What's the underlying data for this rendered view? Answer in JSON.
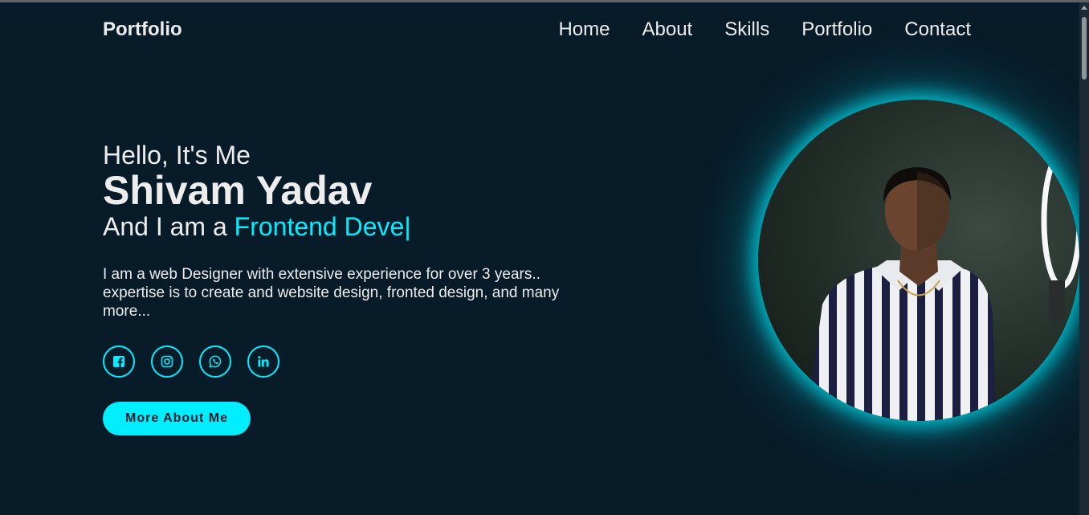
{
  "header": {
    "logo": "Portfolio",
    "nav": [
      "Home",
      "About",
      "Skills",
      "Portfolio",
      "Contact"
    ]
  },
  "hero": {
    "greeting": "Hello, It's Me",
    "name": "Shivam Yadav",
    "role_prefix": "And I am a ",
    "role_highlight": "Frontend Deve|",
    "description": "I am a web Designer with extensive experience for over 3 years.. expertise is to create and website design, fronted design, and many more...",
    "socials": [
      {
        "icon": "facebook-icon"
      },
      {
        "icon": "instagram-icon"
      },
      {
        "icon": "whatsapp-icon"
      },
      {
        "icon": "linkedin-icon"
      }
    ],
    "button_label": "More About Me",
    "photo": {
      "subject": "profile-photo",
      "glow_color": "#00eeff"
    }
  },
  "colors": {
    "background": "#081b29",
    "accent": "#00eeff",
    "text": "#ededed"
  }
}
